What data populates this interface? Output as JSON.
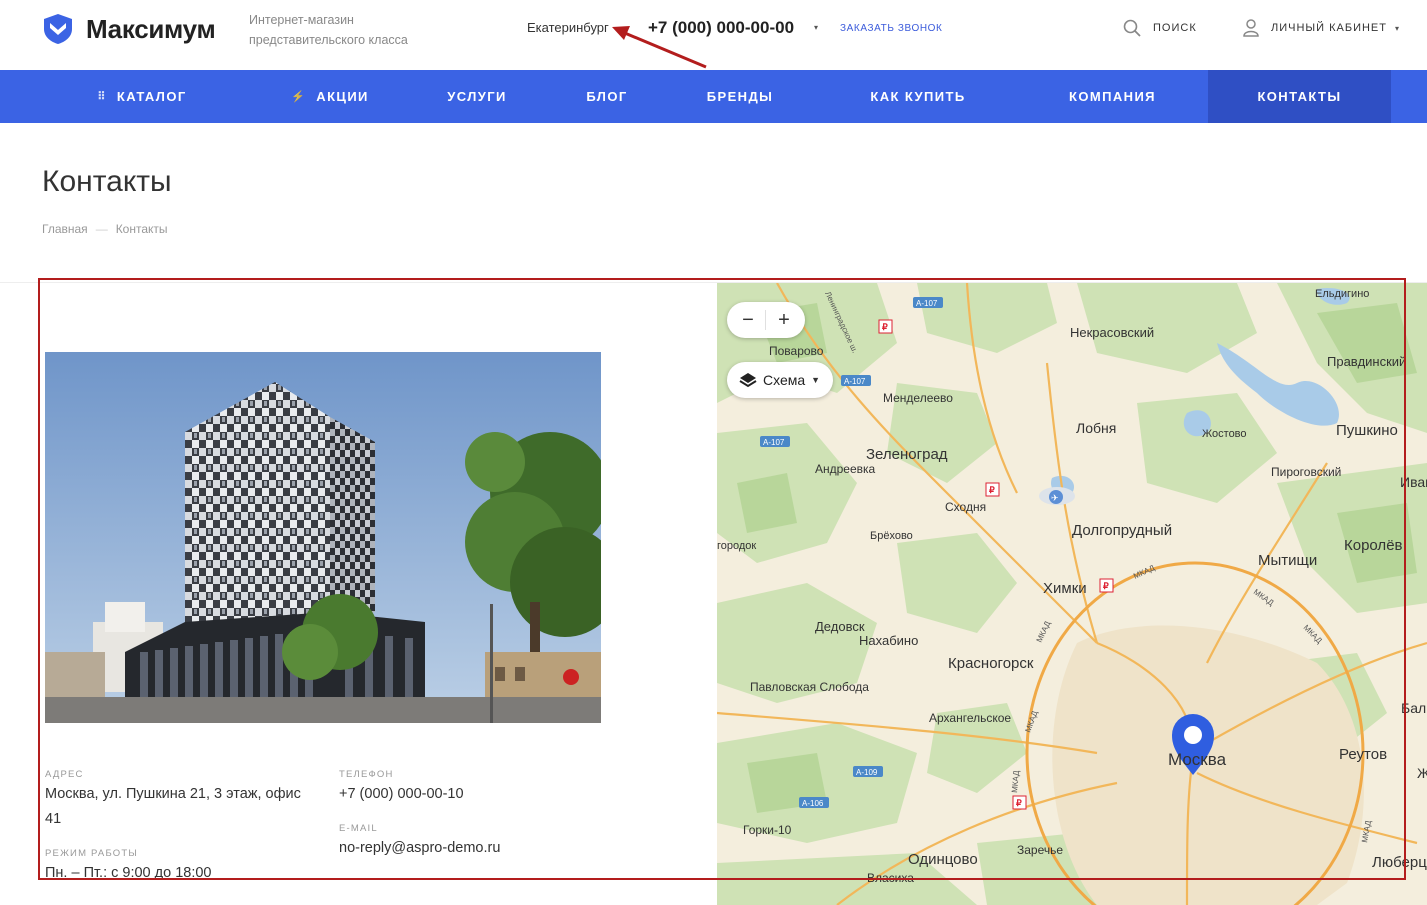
{
  "header": {
    "logo_text": "Максимум",
    "tagline_line1": "Интернет-магазин",
    "tagline_line2": "представительского класса",
    "city": "Екатеринбург",
    "phone": "+7 (000) 000-00-00",
    "callback_label": "ЗАКАЗАТЬ ЗВОНОК",
    "search_label": "ПОИСК",
    "account_label": "ЛИЧНЫЙ КАБИНЕТ",
    "brand_color": "#3b63e4"
  },
  "nav": {
    "items": [
      {
        "label": "КАТАЛОГ",
        "icon": "grid-icon"
      },
      {
        "label": "АКЦИИ",
        "icon": "lightning-icon"
      },
      {
        "label": "УСЛУГИ"
      },
      {
        "label": "БЛОГ"
      },
      {
        "label": "БРЕНДЫ"
      },
      {
        "label": "КАК КУПИТЬ"
      },
      {
        "label": "КОМПАНИЯ"
      },
      {
        "label": "КОНТАКТЫ",
        "active": true
      }
    ]
  },
  "page": {
    "title": "Контакты",
    "breadcrumbs": [
      "Главная",
      "—",
      "Контакты"
    ]
  },
  "contacts": {
    "address_label": "АДРЕС",
    "address_line1": "Москва, ул. Пушкина 21, 3 этаж, офис",
    "address_line2": "41",
    "hours_label": "РЕЖИМ РАБОТЫ",
    "hours": "Пн. – Пт.: с 9:00 до 18:00",
    "phone_label": "ТЕЛЕФОН",
    "phone": "+7 (000) 000-00-10",
    "email_label": "E-MAIL",
    "email": "no-reply@aspro-demo.ru"
  },
  "map": {
    "zoom_out": "−",
    "zoom_in": "+",
    "layer_label": "Схема",
    "places": {
      "eldigino": "Ельдигино",
      "nekrasovsky": "Некрасовский",
      "pravdinsky": "Правдинский",
      "povarovo": "Поварово",
      "mendeleevo": "Менделеево",
      "lobnya": "Лобня",
      "zhostovo": "Жостово",
      "pushkino": "Пушкино",
      "zelenograd": "Зеленоград",
      "andreevka": "Андреевка",
      "pirogovsky": "Пироговский",
      "ivant": "Ивант",
      "skhodnya": "Сходня",
      "dolgoprudny": "Долгопрудный",
      "brekhovo": "Брёхово",
      "gorodok": "городок",
      "korolev": "Королёв",
      "khimki": "Химки",
      "mytishchi": "Мытищи",
      "dedovsk": "Дедовск",
      "nakhabino": "Нахабино",
      "krasnogorsk": "Красногорск",
      "pavlovskaya": "Павловская Слобода",
      "arkhangelskoe": "Архангельское",
      "moskva": "Москва",
      "reutov": "Реутов",
      "bal": "Бал",
      "gorki": "Горки-10",
      "zarechye": "Заречье",
      "odintsovo": "Одинцово",
      "vlasikha": "Власиха",
      "lyubertsy": "Люберц",
      "ro": "Ж"
    },
    "roads": {
      "a107": "А-107",
      "a109": "А-109",
      "a106": "А-106",
      "mkad": "МКАД",
      "leningrad": "Ленинградское ш."
    }
  }
}
